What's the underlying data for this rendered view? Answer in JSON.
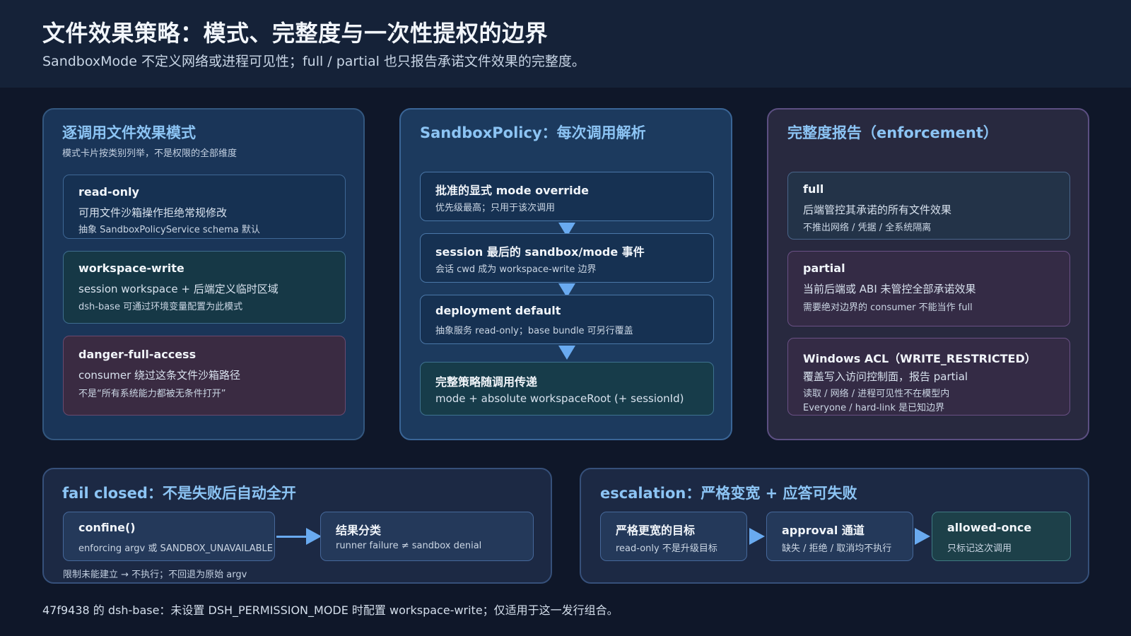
{
  "header": {
    "title": "文件效果策略：模式、完整度与一次性提权的边界",
    "subtitle": "SandboxMode 不定义网络或进程可见性；full / partial 也只报告承诺文件效果的完整度。"
  },
  "modes_panel": {
    "title": "逐调用文件效果模式",
    "subtitle": "模式卡片按类别列举，不是权限的全部维度",
    "cards": [
      {
        "title": "read-only",
        "line1": "可用文件沙箱操作拒绝常规修改",
        "line2": "抽象 SandboxPolicyService schema 默认"
      },
      {
        "title": "workspace-write",
        "line1": "session workspace + 后端定义临时区域",
        "line2": "dsh-base 可通过环境变量配置为此模式"
      },
      {
        "title": "danger-full-access",
        "line1": "consumer 绕过这条文件沙箱路径",
        "line2": "不是“所有系统能力都被无条件打开”"
      }
    ]
  },
  "policy_panel": {
    "title": "SandboxPolicy：每次调用解析",
    "steps": [
      {
        "title": "批准的显式 mode override",
        "line": "优先级最高；只用于该次调用"
      },
      {
        "title": "session 最后的 sandbox/mode 事件",
        "line": "会话 cwd 成为 workspace-write 边界"
      },
      {
        "title": "deployment default",
        "line": "抽象服务 read-only；base bundle 可另行覆盖"
      },
      {
        "title": "完整策略随调用传递",
        "line": "mode + absolute workspaceRoot (+ sessionId)"
      }
    ]
  },
  "enforcement_panel": {
    "title": "完整度报告（enforcement）",
    "cards": [
      {
        "title": "full",
        "line1": "后端管控其承诺的所有文件效果",
        "line2": "不推出网络 / 凭据 / 全系统隔离"
      },
      {
        "title": "partial",
        "line1": "当前后端或 ABI 未管控全部承诺效果",
        "line2": "需要绝对边界的 consumer 不能当作 full"
      },
      {
        "title": "Windows ACL（WRITE_RESTRICTED）",
        "line1": "覆盖写入访问控制面，报告 partial",
        "line2": "读取 / 网络 / 进程可见性不在模型内",
        "line3": "Everyone / hard-link 是已知边界"
      }
    ]
  },
  "fail_panel": {
    "title": "fail closed：不是失败后自动全开",
    "box1": {
      "title": "confine()",
      "line": "enforcing argv 或 SANDBOX_UNAVAILABLE"
    },
    "box2": {
      "title": "结果分类",
      "line": "runner failure ≠ sandbox denial"
    },
    "note": "限制未能建立 → 不执行；不回退为原始 argv"
  },
  "escalation_panel": {
    "title": "escalation：严格变宽 + 应答可失败",
    "box1": {
      "title": "严格更宽的目标",
      "line": "read-only 不是升级目标"
    },
    "box2": {
      "title": "approval 通道",
      "line": "缺失 / 拒绝 / 取消均不执行"
    },
    "box3": {
      "title": "allowed-once",
      "line": "只标记这次调用"
    }
  },
  "footer": "47f9438 的 dsh-base：未设置 DSH_PERMISSION_MODE 时配置 workspace-write；仅适用于这一发行组合。",
  "colors": {
    "background": "#0f1729",
    "panel_blue": "#1c3a5e",
    "panel_purple": "#2a2a44",
    "card_blue": "#163152",
    "card_teal": "#163a45",
    "card_danger": "#3a2a40",
    "accent_title": "#8cc4f4",
    "arrow": "#69aaf0"
  }
}
